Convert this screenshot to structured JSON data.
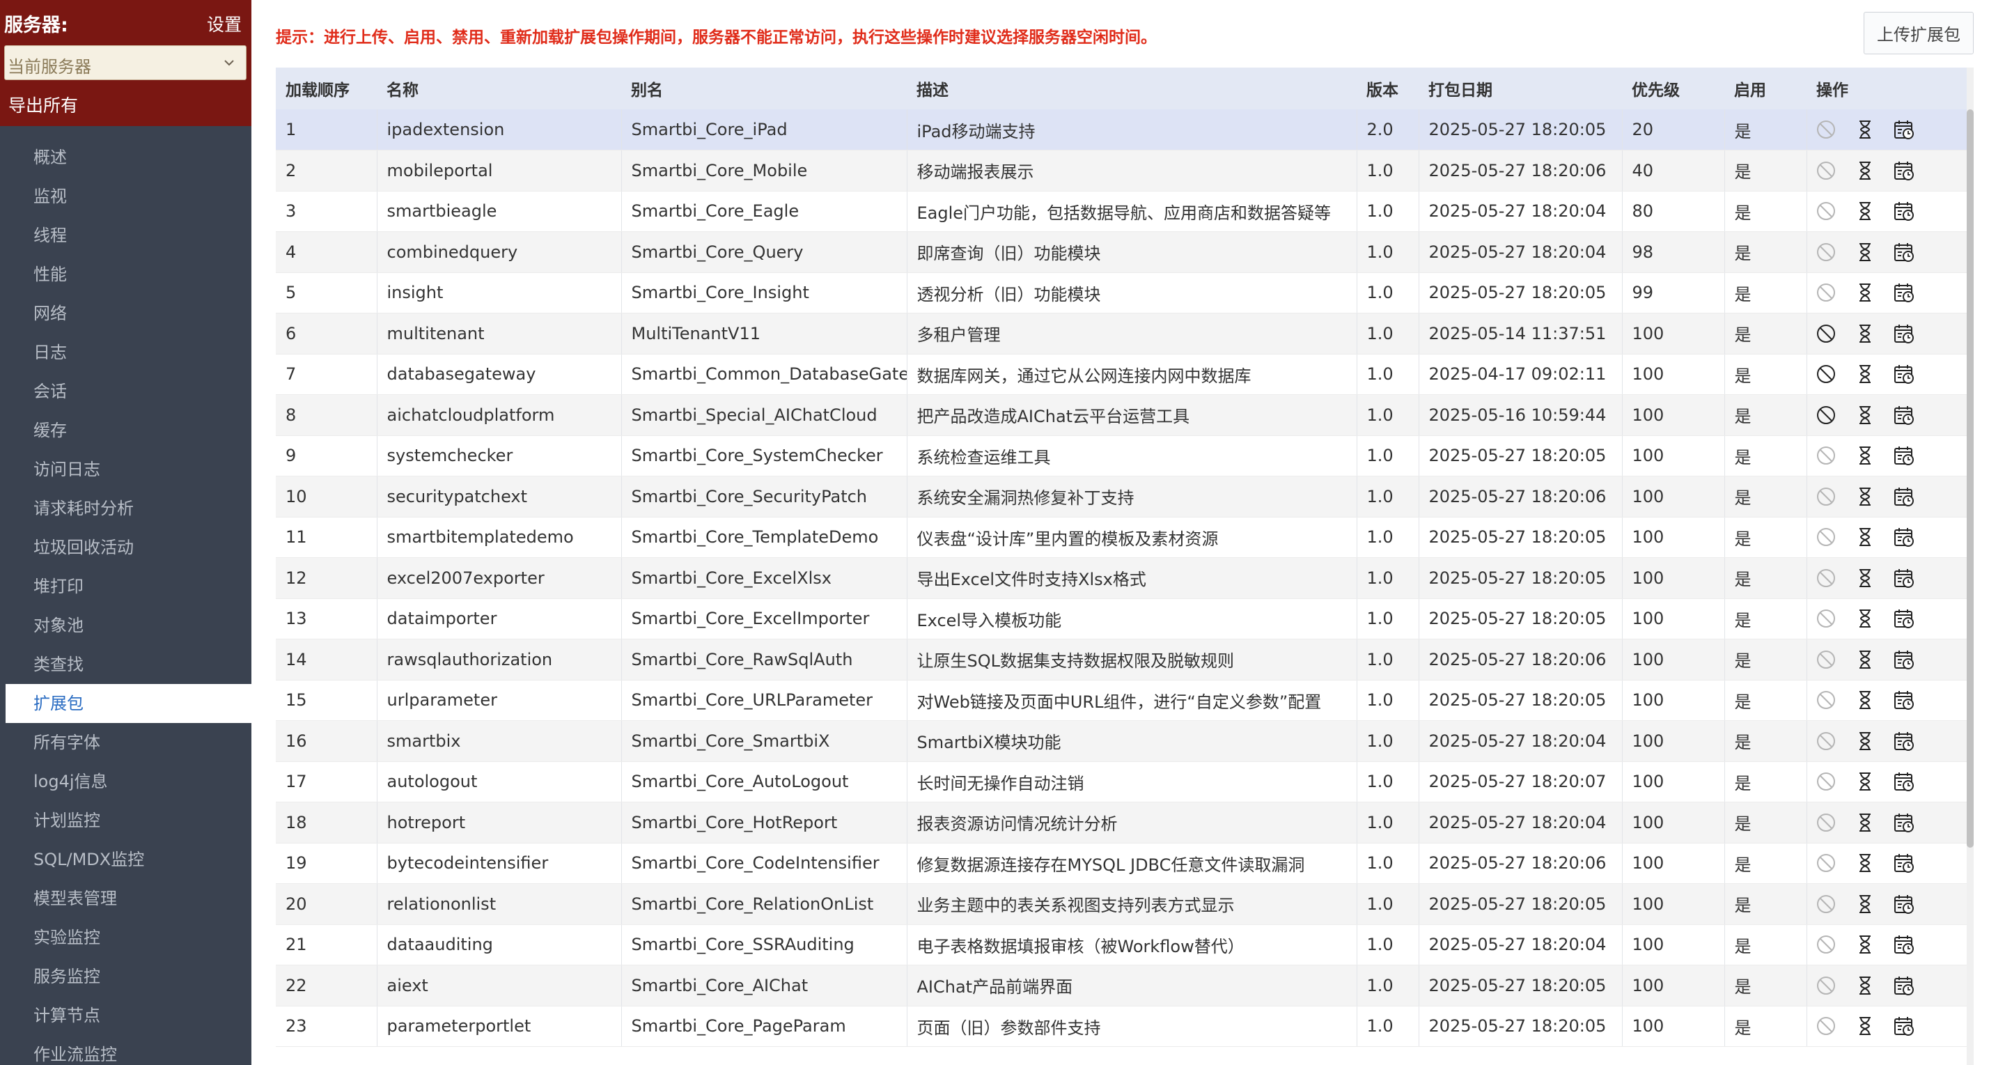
{
  "sidebar": {
    "title": "服务器:",
    "settings_label": "设置",
    "server_select_value": "当前服务器",
    "export_label": "导出所有",
    "menu": [
      {
        "label": "概述"
      },
      {
        "label": "监视"
      },
      {
        "label": "线程"
      },
      {
        "label": "性能"
      },
      {
        "label": "网络"
      },
      {
        "label": "日志"
      },
      {
        "label": "会话"
      },
      {
        "label": "缓存"
      },
      {
        "label": "访问日志"
      },
      {
        "label": "请求耗时分析"
      },
      {
        "label": "垃圾回收活动"
      },
      {
        "label": "堆打印"
      },
      {
        "label": "对象池"
      },
      {
        "label": "类查找"
      },
      {
        "label": "扩展包",
        "active": true
      },
      {
        "label": "所有字体"
      },
      {
        "label": "log4j信息"
      },
      {
        "label": "计划监控"
      },
      {
        "label": "SQL/MDX监控"
      },
      {
        "label": "模型表管理"
      },
      {
        "label": "实验监控"
      },
      {
        "label": "服务监控"
      },
      {
        "label": "计算节点"
      },
      {
        "label": "作业流监控"
      }
    ]
  },
  "main": {
    "tip": "提示：进行上传、启用、禁用、重新加载扩展包操作期间，服务器不能正常访问，执行这些操作时建议选择服务器空闲时间。",
    "upload_label": "上传扩展包",
    "columns": [
      "加载顺序",
      "名称",
      "别名",
      "描述",
      "版本",
      "打包日期",
      "优先级",
      "启用",
      "操作"
    ],
    "rows": [
      {
        "order": "1",
        "name": "ipadextension",
        "alias": "Smartbi_Core_iPad",
        "desc": "iPad移动端支持",
        "version": "2.0",
        "date": "2025-05-27 18:20:05",
        "priority": "20",
        "enabled": "是"
      },
      {
        "order": "2",
        "name": "mobileportal",
        "alias": "Smartbi_Core_Mobile",
        "desc": "移动端报表展示",
        "version": "1.0",
        "date": "2025-05-27 18:20:06",
        "priority": "40",
        "enabled": "是"
      },
      {
        "order": "3",
        "name": "smartbieagle",
        "alias": "Smartbi_Core_Eagle",
        "desc": "Eagle门户功能，包括数据导航、应用商店和数据答疑等",
        "version": "1.0",
        "date": "2025-05-27 18:20:04",
        "priority": "80",
        "enabled": "是"
      },
      {
        "order": "4",
        "name": "combinedquery",
        "alias": "Smartbi_Core_Query",
        "desc": "即席查询（旧）功能模块",
        "version": "1.0",
        "date": "2025-05-27 18:20:04",
        "priority": "98",
        "enabled": "是"
      },
      {
        "order": "5",
        "name": "insight",
        "alias": "Smartbi_Core_Insight",
        "desc": "透视分析（旧）功能模块",
        "version": "1.0",
        "date": "2025-05-27 18:20:05",
        "priority": "99",
        "enabled": "是"
      },
      {
        "order": "6",
        "name": "multitenant",
        "alias": "MultiTenantV11",
        "desc": "多租户管理",
        "version": "1.0",
        "date": "2025-05-14 11:37:51",
        "priority": "100",
        "enabled": "是"
      },
      {
        "order": "7",
        "name": "databasegateway",
        "alias": "Smartbi_Common_DatabaseGatew",
        "desc": "数据库网关，通过它从公网连接内网中数据库",
        "version": "1.0",
        "date": "2025-04-17 09:02:11",
        "priority": "100",
        "enabled": "是"
      },
      {
        "order": "8",
        "name": "aichatcloudplatform",
        "alias": "Smartbi_Special_AIChatCloud",
        "desc": "把产品改造成AIChat云平台运营工具",
        "version": "1.0",
        "date": "2025-05-16 10:59:44",
        "priority": "100",
        "enabled": "是"
      },
      {
        "order": "9",
        "name": "systemchecker",
        "alias": "Smartbi_Core_SystemChecker",
        "desc": "系统检查运维工具",
        "version": "1.0",
        "date": "2025-05-27 18:20:05",
        "priority": "100",
        "enabled": "是"
      },
      {
        "order": "10",
        "name": "securitypatchext",
        "alias": "Smartbi_Core_SecurityPatch",
        "desc": "系统安全漏洞热修复补丁支持",
        "version": "1.0",
        "date": "2025-05-27 18:20:06",
        "priority": "100",
        "enabled": "是"
      },
      {
        "order": "11",
        "name": "smartbitemplatedemo",
        "alias": "Smartbi_Core_TemplateDemo",
        "desc": "仪表盘“设计库”里内置的模板及素材资源",
        "version": "1.0",
        "date": "2025-05-27 18:20:05",
        "priority": "100",
        "enabled": "是"
      },
      {
        "order": "12",
        "name": "excel2007exporter",
        "alias": "Smartbi_Core_ExcelXlsx",
        "desc": "导出Excel文件时支持Xlsx格式",
        "version": "1.0",
        "date": "2025-05-27 18:20:05",
        "priority": "100",
        "enabled": "是"
      },
      {
        "order": "13",
        "name": "dataimporter",
        "alias": "Smartbi_Core_ExcelImporter",
        "desc": "Excel导入模板功能",
        "version": "1.0",
        "date": "2025-05-27 18:20:05",
        "priority": "100",
        "enabled": "是"
      },
      {
        "order": "14",
        "name": "rawsqlauthorization",
        "alias": "Smartbi_Core_RawSqlAuth",
        "desc": "让原生SQL数据集支持数据权限及脱敏规则",
        "version": "1.0",
        "date": "2025-05-27 18:20:06",
        "priority": "100",
        "enabled": "是"
      },
      {
        "order": "15",
        "name": "urlparameter",
        "alias": "Smartbi_Core_URLParameter",
        "desc": "对Web链接及页面中URL组件，进行“自定义参数”配置",
        "version": "1.0",
        "date": "2025-05-27 18:20:05",
        "priority": "100",
        "enabled": "是"
      },
      {
        "order": "16",
        "name": "smartbix",
        "alias": "Smartbi_Core_SmartbiX",
        "desc": "SmartbiX模块功能",
        "version": "1.0",
        "date": "2025-05-27 18:20:04",
        "priority": "100",
        "enabled": "是"
      },
      {
        "order": "17",
        "name": "autologout",
        "alias": "Smartbi_Core_AutoLogout",
        "desc": "长时间无操作自动注销",
        "version": "1.0",
        "date": "2025-05-27 18:20:07",
        "priority": "100",
        "enabled": "是"
      },
      {
        "order": "18",
        "name": "hotreport",
        "alias": "Smartbi_Core_HotReport",
        "desc": "报表资源访问情况统计分析",
        "version": "1.0",
        "date": "2025-05-27 18:20:04",
        "priority": "100",
        "enabled": "是"
      },
      {
        "order": "19",
        "name": "bytecodeintensifier",
        "alias": "Smartbi_Core_CodeIntensifier",
        "desc": "修复数据源连接存在MYSQL JDBC任意文件读取漏洞",
        "version": "1.0",
        "date": "2025-05-27 18:20:06",
        "priority": "100",
        "enabled": "是"
      },
      {
        "order": "20",
        "name": "relationonlist",
        "alias": "Smartbi_Core_RelationOnList",
        "desc": "业务主题中的表关系视图支持列表方式显示",
        "version": "1.0",
        "date": "2025-05-27 18:20:05",
        "priority": "100",
        "enabled": "是"
      },
      {
        "order": "21",
        "name": "dataauditing",
        "alias": "Smartbi_Core_SSRAuditing",
        "desc": "电子表格数据填报审核（被Workflow替代）",
        "version": "1.0",
        "date": "2025-05-27 18:20:04",
        "priority": "100",
        "enabled": "是"
      },
      {
        "order": "22",
        "name": "aiext",
        "alias": "Smartbi_Core_AIChat",
        "desc": "AIChat产品前端界面",
        "version": "1.0",
        "date": "2025-05-27 18:20:05",
        "priority": "100",
        "enabled": "是"
      },
      {
        "order": "23",
        "name": "parameterportlet",
        "alias": "Smartbi_Core_PageParam",
        "desc": "页面（旧）参数部件支持",
        "version": "1.0",
        "date": "2025-05-27 18:20:05",
        "priority": "100",
        "enabled": "是"
      }
    ]
  },
  "icons": {
    "disable": "disable-icon",
    "reload": "hourglass-icon",
    "detail": "calendar-clock-icon"
  },
  "colors": {
    "sidebar_header": "#7a1712",
    "sidebar_bg": "#3a4250",
    "tip_red": "#e02c1a",
    "active_blue": "#2a6cc2",
    "header_row": "#e3e8f4"
  }
}
